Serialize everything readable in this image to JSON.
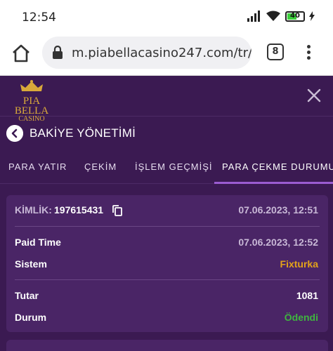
{
  "status_bar": {
    "time": "12:54",
    "battery": "40"
  },
  "browser": {
    "url": "m.piabellacasino247.com/tr/",
    "tab_count": "8"
  },
  "site": {
    "logo_main": "PIA BELLA",
    "logo_sub": "CASINO"
  },
  "page": {
    "title": "BAKİYE YÖNETİMİ"
  },
  "tabs": [
    {
      "label": "PARA YATIR"
    },
    {
      "label": "ÇEKİM"
    },
    {
      "label": "İŞLEM GEÇMİŞİ"
    },
    {
      "label": "PARA ÇEKME DURUMU"
    }
  ],
  "transaction": {
    "id_label": "KİMLİK:",
    "id_value": "197615431",
    "created": "07.06.2023, 12:51",
    "paid_time_label": "Paid Time",
    "paid_time": "07.06.2023, 12:52",
    "system_label": "Sistem",
    "system": "Fixturka",
    "amount_label": "Tutar",
    "amount": "1081",
    "status_label": "Durum",
    "status": "Ödendi"
  },
  "colors": {
    "bg": "#3b1a52",
    "card": "#4a2566",
    "accent": "#9b5cd1",
    "system": "#e3a21a",
    "status_paid": "#3fb53f",
    "battery": "#3ccf3c"
  },
  "icons": [
    "signal-icon",
    "wifi-icon",
    "battery-icon",
    "charging-icon",
    "home-icon",
    "lock-icon",
    "close-icon",
    "chevron-left-icon",
    "copy-icon",
    "more-vert-icon"
  ]
}
